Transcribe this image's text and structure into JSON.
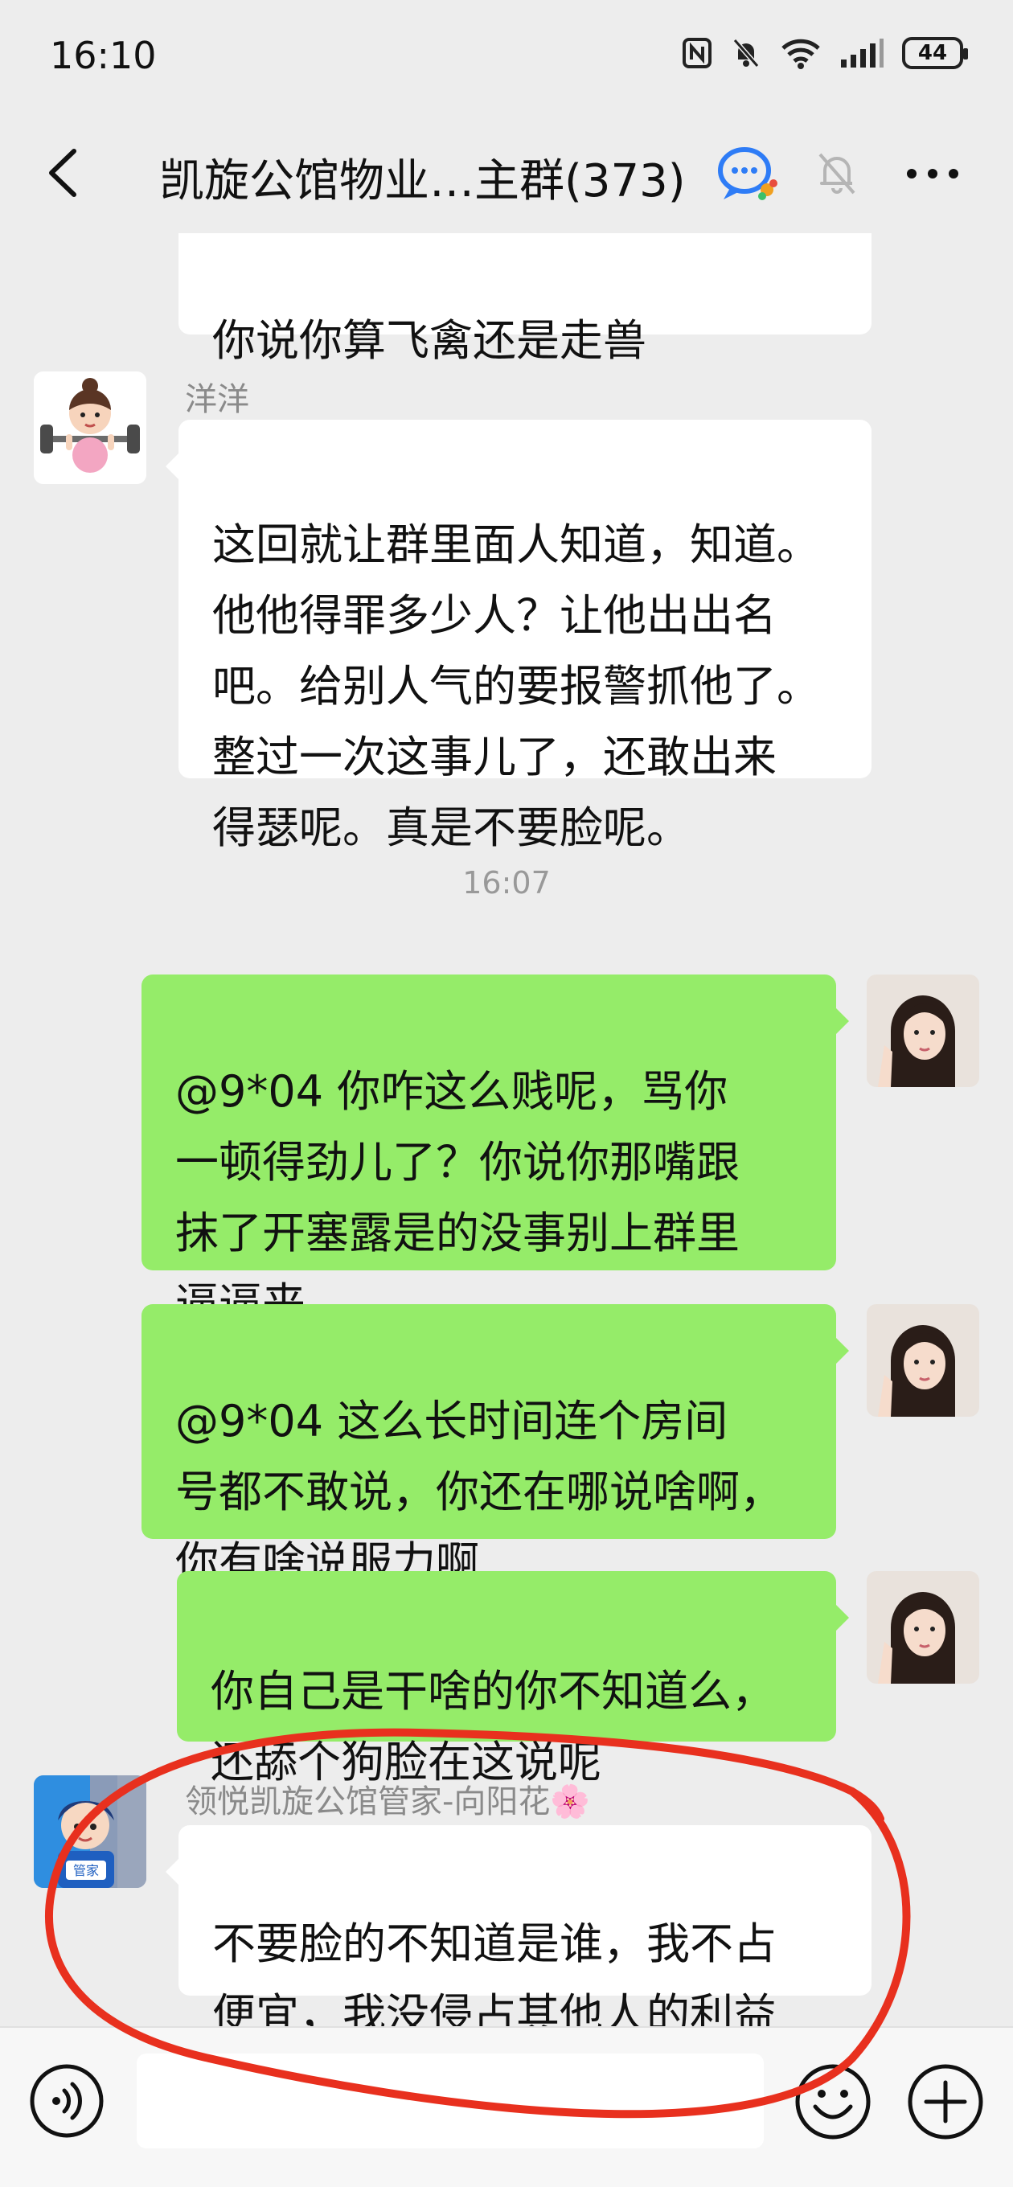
{
  "status_bar": {
    "time": "16:10",
    "battery": "44"
  },
  "header": {
    "title": "凯旋公馆物业…主群(373)"
  },
  "messages": {
    "top_partial": {
      "text": "你说你算飞禽还是走兽"
    },
    "yangyang": {
      "sender": "洋洋",
      "text": "这回就让群里面人知道，知道。\n他他得罪多少人？让他出出名\n吧。给别人气的要报警抓他了。\n整过一次这事儿了，还敢出来\n得瑟呢。真是不要脸呢。"
    },
    "timestamp": "16:07",
    "outgoing": [
      {
        "text": "@9*04  你咋这么贱呢，骂你\n一顿得劲儿了？你说你那嘴跟\n抹了开塞露是的没事别上群里\n逼逼来"
      },
      {
        "text": "@9*04  这么长时间连个房间\n号都不敢说，你还在哪说啥啊，\n你有啥说服力啊"
      },
      {
        "text": "你自己是干啥的你不知道么，\n还舔个狗脸在这说呢"
      }
    ],
    "manager": {
      "sender": "领悦凯旋公馆管家-向阳花🌸",
      "avatar_label": "管家",
      "text": "不要脸的不知道是谁，我不占\n便宜，我没侵占其他人的利益"
    }
  },
  "input_bar": {
    "placeholder": ""
  },
  "colors": {
    "background": "#ededed",
    "outgoing_bubble": "#95ec69",
    "incoming_bubble": "#ffffff",
    "annotation": "#e8301e"
  }
}
